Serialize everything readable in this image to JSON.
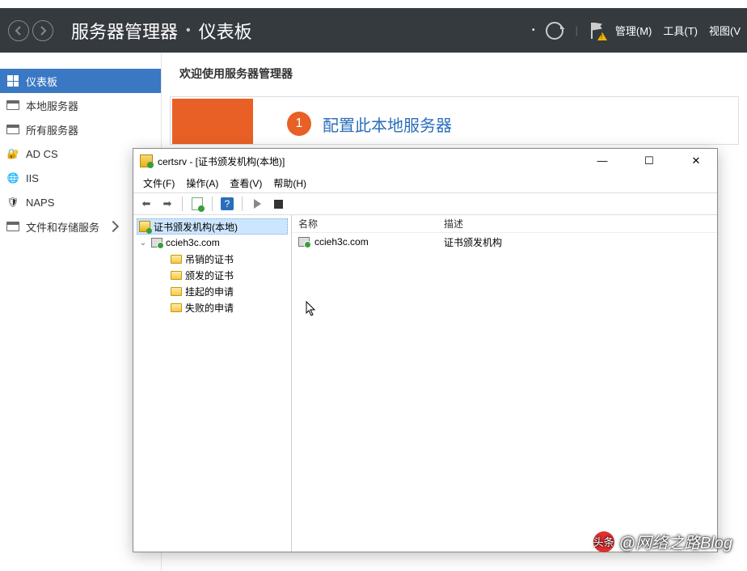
{
  "header": {
    "app_title": "服务器管理器",
    "page": "仪表板",
    "menu_manage": "管理(M)",
    "menu_tools": "工具(T)",
    "menu_view": "视图(V"
  },
  "sidebar": {
    "items": [
      {
        "label": "仪表板"
      },
      {
        "label": "本地服务器"
      },
      {
        "label": "所有服务器"
      },
      {
        "label": "AD CS"
      },
      {
        "label": "IIS"
      },
      {
        "label": "NAPS"
      },
      {
        "label": "文件和存储服务"
      }
    ]
  },
  "content": {
    "welcome": "欢迎使用服务器管理器",
    "step_number": "1",
    "quick_link": "配置此本地服务器"
  },
  "cert_window": {
    "title": "certsrv - [证书颁发机构(本地)]",
    "controls": {
      "min": "—",
      "max": "☐",
      "close": "✕"
    },
    "menu": {
      "file": "文件(F)",
      "action": "操作(A)",
      "view": "查看(V)",
      "help": "帮助(H)"
    },
    "tree": {
      "root": "证书颁发机构(本地)",
      "server": "ccieh3c.com",
      "children": [
        "吊销的证书",
        "颁发的证书",
        "挂起的申请",
        "失败的申请"
      ]
    },
    "list": {
      "col_name": "名称",
      "col_desc": "描述",
      "rows": [
        {
          "name": "ccieh3c.com",
          "desc": "证书颁发机构"
        }
      ]
    }
  },
  "watermark": {
    "badge": "头条",
    "text": "@网络之路Blog"
  }
}
